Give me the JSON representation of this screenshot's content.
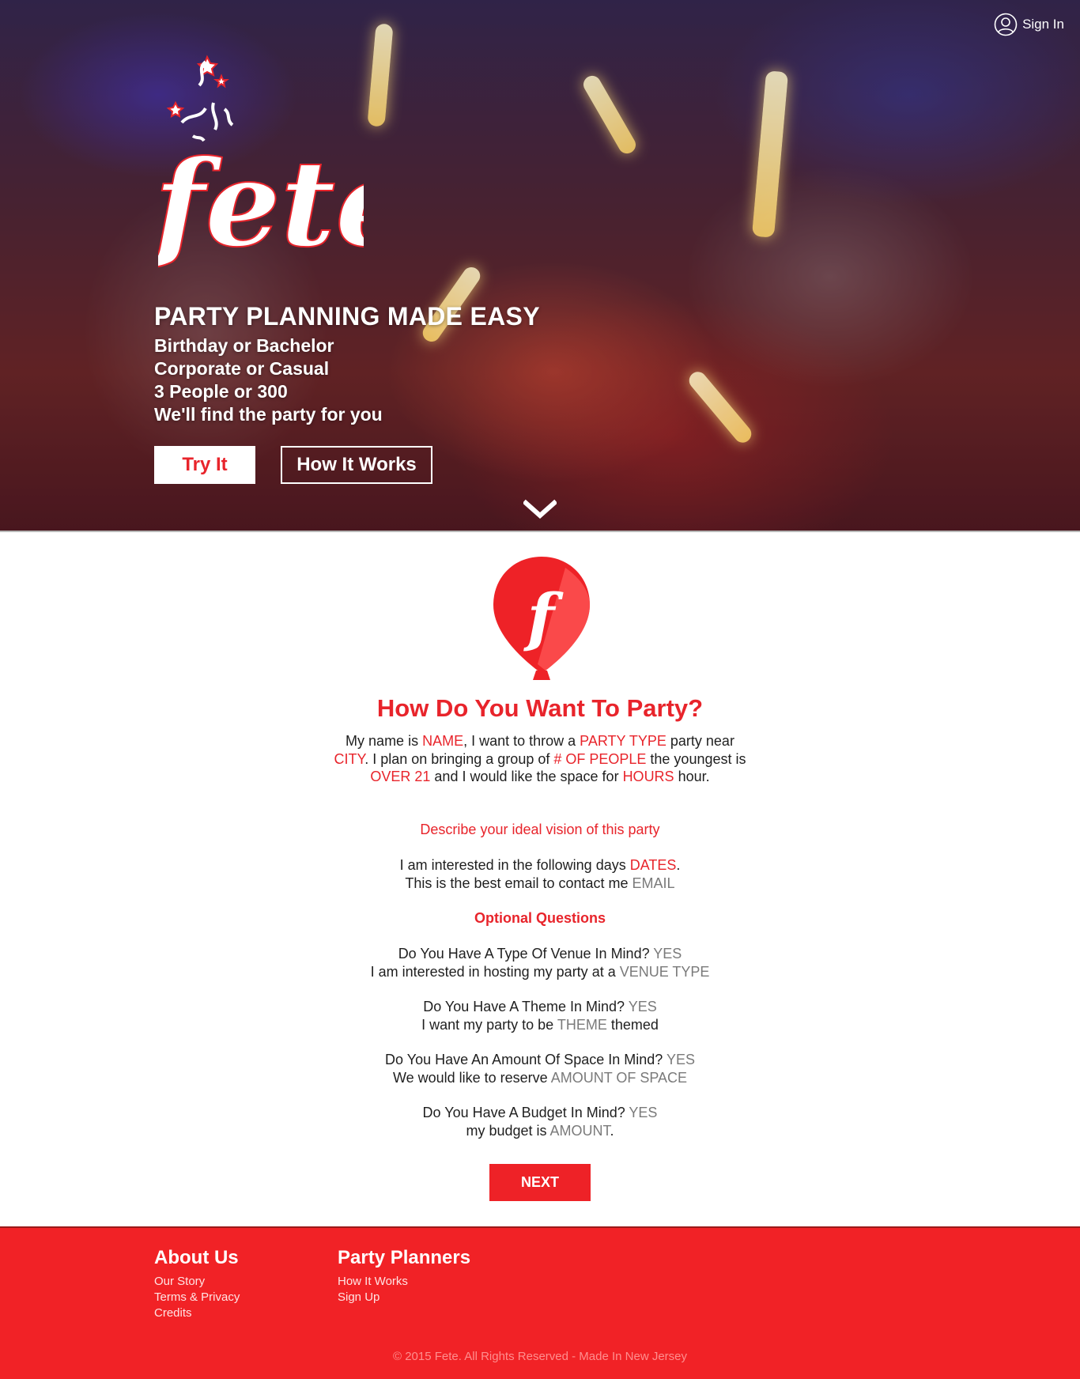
{
  "header": {
    "signin_label": "Sign In",
    "logo_text": "fete"
  },
  "hero": {
    "headline": "PARTY PLANNING MADE EASY",
    "taglines": [
      "Birthday or Bachelor",
      "Corporate or Casual",
      "3 People or 300",
      "We'll find the party for you"
    ],
    "try_label": "Try It",
    "how_label": "How It Works"
  },
  "form": {
    "badge_letter": "f",
    "title": "How Do You Want To Party?",
    "p1": {
      "t1": "My name is ",
      "name": "NAME",
      "t2": ", I want to throw a ",
      "party_type": "PARTY TYPE",
      "t3": " party near ",
      "city": "CITY",
      "t4": ". I plan on bringing a group of ",
      "people": "# OF PEOPLE",
      "t5": "  the youngest is ",
      "age": "OVER 21",
      "t6": " and I would like the space for ",
      "hours": "HOURS",
      "t7": " hour."
    },
    "vision": "Describe your ideal vision of this party",
    "p3": {
      "t1": "I am interested in the following days  ",
      "dates": "DATES",
      "t2": ".",
      "t3": "This is the best email to contact me ",
      "email": "EMAIL"
    },
    "optional_heading": "Optional Questions",
    "venue": {
      "q": "Do You Have A Type Of Venue In Mind? ",
      "a": "YES",
      "t": "I am interested in hosting my party at a ",
      "v": "VENUE TYPE"
    },
    "theme": {
      "q": "Do You Have A Theme In Mind? ",
      "a": "YES",
      "t1": "I want my party to be ",
      "v": "THEME",
      "t2": " themed"
    },
    "space": {
      "q": "Do You Have An Amount Of Space In Mind? ",
      "a": "YES",
      "t": "We would like to reserve ",
      "v": "AMOUNT OF SPACE"
    },
    "budget": {
      "q": "Do You Have A Budget In Mind? ",
      "a": "YES",
      "t1": "my budget is ",
      "v": "AMOUNT",
      "t2": "."
    },
    "next_label": "NEXT"
  },
  "footer": {
    "about": {
      "heading": "About Us",
      "links": [
        "Our Story",
        "Terms & Privacy",
        "Credits"
      ]
    },
    "planners": {
      "heading": "Party Planners",
      "links": [
        "How It Works",
        "Sign Up"
      ]
    },
    "copyright": "© 2015 Fete. All Rights Reserved - Made In New Jersey"
  },
  "colors": {
    "brand_red": "#e8242b",
    "footer_red": "#f12226",
    "muted_grey": "#7a7a7a"
  },
  "icons": [
    "user-circle-icon",
    "chevron-down-icon",
    "balloon-icon",
    "confetti-icon"
  ]
}
